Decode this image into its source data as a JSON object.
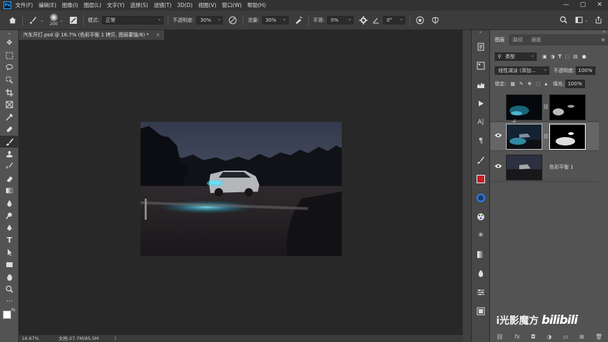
{
  "app": {
    "logo": "Ps"
  },
  "menu": [
    "文件(F)",
    "编辑(E)",
    "图像(I)",
    "图层(L)",
    "文字(Y)",
    "选择(S)",
    "滤镜(T)",
    "3D(D)",
    "视图(V)",
    "窗口(W)",
    "帮助(H)"
  ],
  "window_controls": {
    "minimize": "—",
    "maximize": "▢",
    "close": "✕"
  },
  "options": {
    "brush_size": "200",
    "mode_label": "模式:",
    "mode_value": "正常",
    "opacity_label": "不透明度:",
    "opacity_value": "30%",
    "flow_label": "流量:",
    "flow_value": "30%",
    "smooth_label": "平滑:",
    "smooth_value": "0%",
    "angle_value": "0°"
  },
  "document": {
    "tab_title": "汽车开灯.psd @ 16.7% (色彩平衡 1 拷贝, 图层蒙版/8) *",
    "close": "×"
  },
  "status": {
    "zoom": "16.67%",
    "doc_info": "文档:27.7M/85.5M",
    "arrow": "〉"
  },
  "panel": {
    "tabs": [
      "图层",
      "路径",
      "通道"
    ],
    "filter_label": "类型",
    "blend_mode": "线性减淡 (添加...",
    "opacity_label": "不透明度:",
    "opacity_value": "100%",
    "lock_label": "锁定:",
    "fill_label": "填充:",
    "fill_value": "100%",
    "layers": [
      {
        "name": "",
        "visible": false
      },
      {
        "name": "",
        "visible": true
      },
      {
        "name": "色彩平衡 1",
        "visible": true
      }
    ]
  },
  "watermark": {
    "channel": "i光影魔方",
    "brand": "bilibili"
  },
  "colors": {
    "accent": "#31a8ff",
    "app_bg": "#535353",
    "canvas_bg": "#282828",
    "menu_bg": "#323232"
  }
}
